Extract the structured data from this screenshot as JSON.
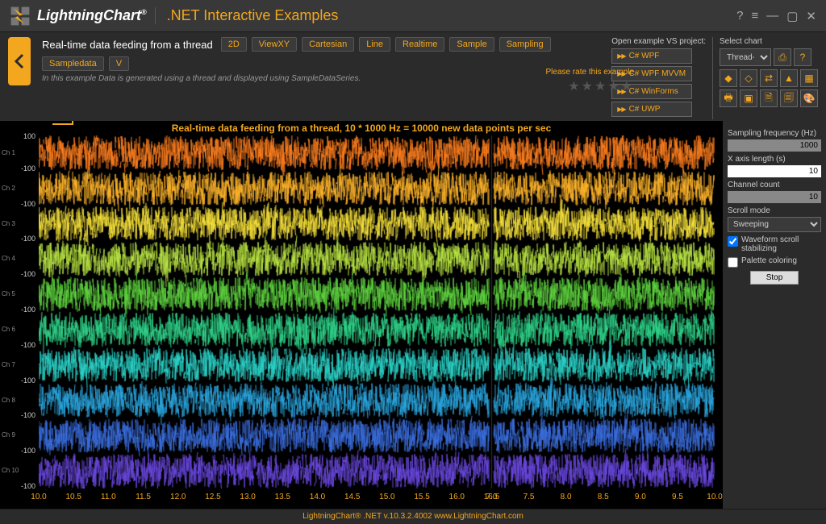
{
  "brand": "LightningChart",
  "brand_reg": "®",
  "subtitle": ".NET Interactive Examples",
  "window": {
    "help": "?",
    "menu": "≡",
    "min": "—",
    "max": "▢",
    "close": "✕"
  },
  "crumb": {
    "title": "Real-time data feeding from a thread",
    "tags": [
      "2D",
      "ViewXY",
      "Cartesian",
      "Line",
      "Realtime",
      "Sample",
      "Sampling",
      "Sampledata",
      "V"
    ],
    "desc": "In this example Data is generated using a thread and displayed using SampleDataSeries."
  },
  "rate": {
    "label": "Please rate this example",
    "stars": "★★★★★"
  },
  "vs": {
    "label": "Open example VS project:",
    "buttons": [
      "C# WPF",
      "C# WPF MVVM",
      "C# WinForms",
      "C# UWP"
    ]
  },
  "select": {
    "label": "Select chart",
    "combo": "Thread-fe",
    "help": "?"
  },
  "chart_data": {
    "type": "line",
    "title": "Real-time data feeding from a thread, 10 * 1000 Hz = 10000 new data points per sec",
    "channel_count": 10,
    "channel_labels": [
      "Ch 1",
      "Ch 2",
      "Ch 3",
      "Ch 4",
      "Ch 5",
      "Ch 6",
      "Ch 7",
      "Ch 8",
      "Ch 9",
      "Ch 10"
    ],
    "y_tick_values": [
      100,
      -100,
      -100,
      -100,
      -100,
      -100,
      -100,
      -100,
      -100,
      -100,
      -100
    ],
    "y_per_channel_range": [
      -100,
      100
    ],
    "x_ticks_left": [
      10.0,
      10.5,
      11.0,
      11.5,
      12.0,
      12.5,
      13.0,
      13.5,
      14.0,
      14.5,
      15.0,
      15.5,
      16.0,
      16.5
    ],
    "x_ticks_right": [
      7.0,
      7.5,
      8.0,
      8.5,
      9.0,
      9.5,
      10.0
    ],
    "sweep_split_fraction": 0.67,
    "channel_colors": [
      "#ff7f1f",
      "#ffb42a",
      "#f7e23a",
      "#b9e443",
      "#5fd43f",
      "#2fd48a",
      "#2bd3c8",
      "#2aa7e0",
      "#3b6fe0",
      "#6a48e0"
    ],
    "amplitude": 90,
    "description": "10 stacked noisy waveform channels sweeping left-to-right; each channel is dense random-walk line data filling ±~90 around its own baseline."
  },
  "sidebar": {
    "sampling_label": "Sampling frequency (Hz)",
    "sampling_value": "1000",
    "xaxis_label": "X axis length (s)",
    "xaxis_value": "10",
    "chcount_label": "Channel count",
    "chcount_value": "10",
    "scroll_label": "Scroll mode",
    "scroll_value": "Sweeping",
    "cb_waveform": "Waveform scroll stabilizing",
    "cb_waveform_checked": true,
    "cb_palette": "Palette coloring",
    "cb_palette_checked": false,
    "stop_btn": "Stop"
  },
  "footer": "LightningChart® .NET v.10.3.2.4002  www.LightningChart.com"
}
